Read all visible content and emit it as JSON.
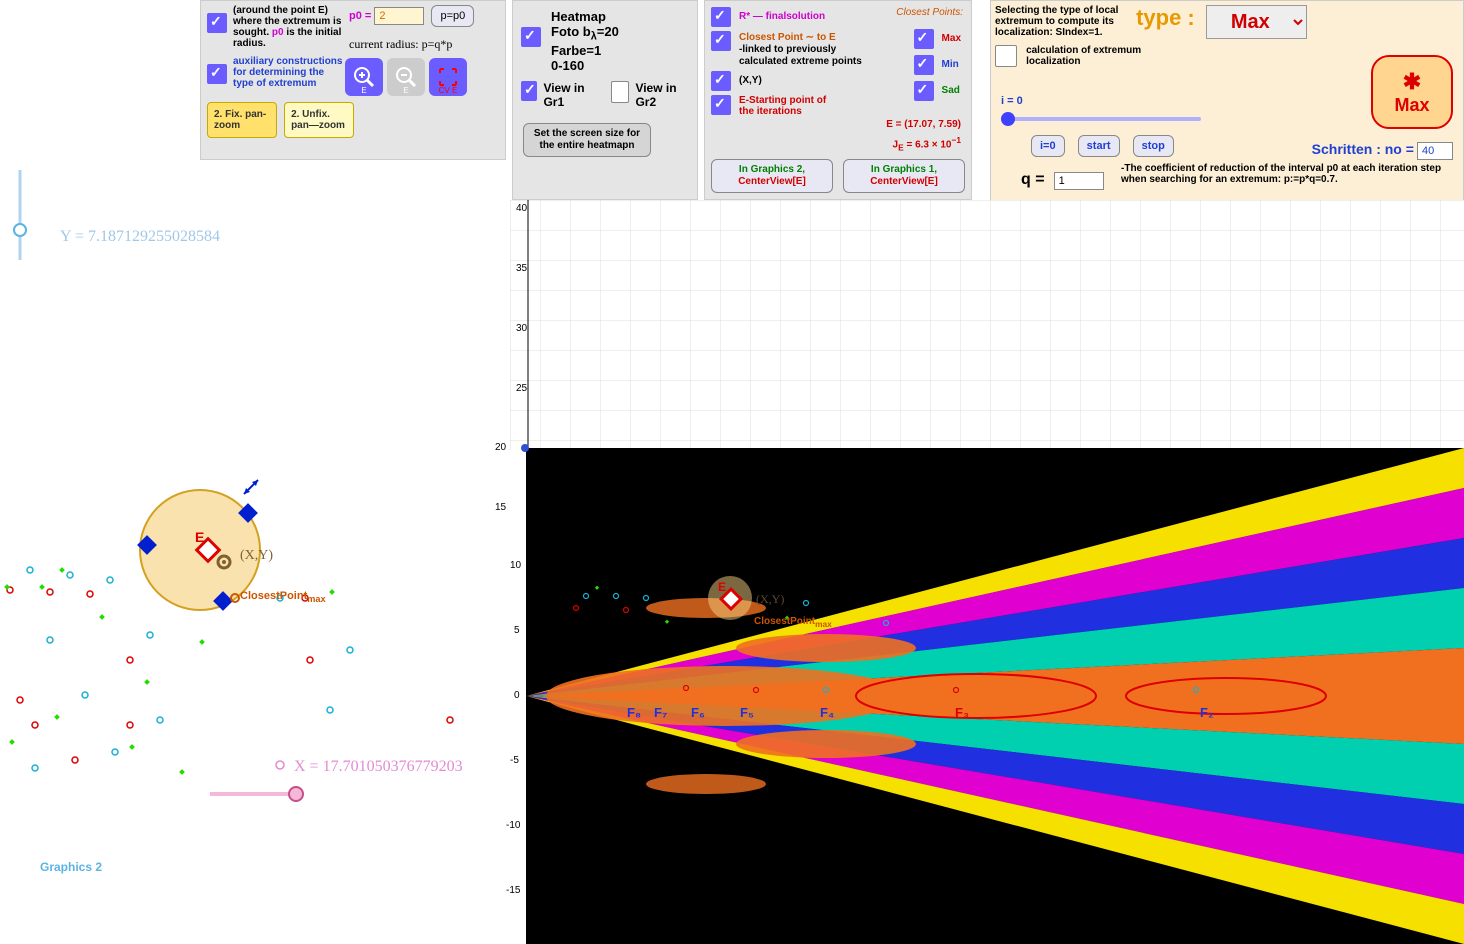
{
  "panel1": {
    "desc1_a": "(around the point E) where the extremum is sought. ",
    "desc1_b": "p0",
    "desc1_c": " is the initial radius.",
    "desc2": "auxiliary constructions for determining the type of extremum",
    "p0_label": "p0 =",
    "p0_value": "2",
    "btn_p": "p=p0",
    "radius_text": "current radius: p=q*p",
    "fix": "2. Fix. pan-zoom",
    "unfix": "2. Unfix. pan—zoom",
    "zoom_e": "E",
    "cv_e": "CV E"
  },
  "panel2": {
    "heatmap": "Heatmap",
    "foto_line1": "Foto b",
    "foto_sub": "λ",
    "foto_val": "=20",
    "farbe": "Farbe=1",
    "range": "0-160",
    "view_gr1": "View in Gr1",
    "view_gr2": "View in Gr2",
    "screen_btn": "Set the screen size for the entire heatmapn"
  },
  "panel3": {
    "r_final": "R* — finalsolution",
    "closest_header": "Closest Points:",
    "closest_e": "Closest Point ∼ to E",
    "linked": "-linked to previously calculated extreme points",
    "xy": "(X,Y)",
    "start_pt": "E-Starting point of the iterations",
    "max": "Max",
    "min": "Min",
    "sad": "Sad",
    "e_val": "E = (17.07, 7.59)",
    "je_val": "J",
    "je_sub": "E",
    "je_rest": " = 6.3 × 10",
    "je_exp": "−1",
    "g2_a": "In Graphics 2,",
    "g2_b": "CenterView[E]",
    "g1_a": "In Graphics 1,",
    "g1_b": "CenterView[E]"
  },
  "panel4": {
    "desc": "Selecting the type of local extremum to compute its localization: SIndex=1.",
    "type_label": "type :",
    "type_value": "Max",
    "calc_loc": "calculation of extremum localization",
    "i_eq": "i = 0",
    "i0": "i=0",
    "start": "start",
    "stop": "stop",
    "schritten": "Schritten :  no =",
    "no_val": "40",
    "q_label": "q =",
    "q_val": "1",
    "q_desc": "-The coefficient of reduction of the interval p0 at each iteration step when searching for an extremum: p:=p*q=0.7.",
    "star": "✱",
    "star_label": "Max"
  },
  "graphics": {
    "y_label": "Y = 7.187129255028584",
    "x_label": "X = 17.701050376779203",
    "e_label": "E",
    "xy_label": "(X,Y)",
    "closest_label": "ClosestPoint",
    "closest_sub": "max",
    "g2_label": "Graphics 2",
    "ticks_y": [
      "40",
      "35",
      "30",
      "25"
    ],
    "ticks_y2": [
      "10",
      "5",
      "0",
      "-5",
      "-10",
      "-15"
    ],
    "f_labels": [
      "F₈",
      "F₇",
      "F₆",
      "F₅",
      "F₄",
      "F₃",
      "F₂"
    ],
    "heat_e": "E",
    "heat_xy": "(X,Y)",
    "heat_cp": "ClosestPoint",
    "heat_cp_sub": "max"
  }
}
